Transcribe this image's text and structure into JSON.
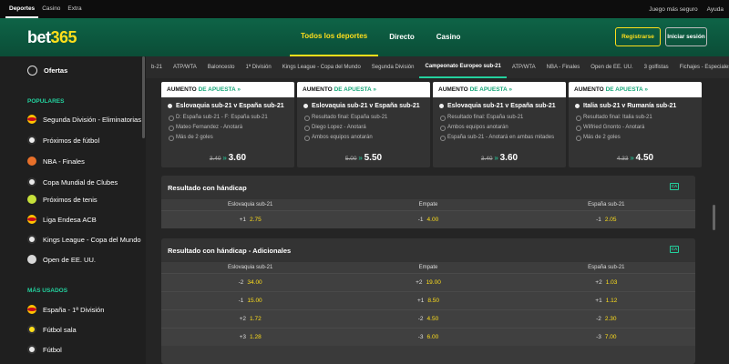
{
  "topbar": {
    "tabs": [
      "Deportes",
      "Casino",
      "Extra"
    ],
    "links": [
      "Juego más seguro",
      "Ayuda"
    ]
  },
  "header": {
    "logo_main": "bet",
    "logo_accent": "365",
    "nav": [
      "Todos los deportes",
      "Directo",
      "Casino"
    ],
    "register": "Registrarse",
    "login": "Iniciar sesión"
  },
  "sidebar": {
    "offers": "Ofertas",
    "popular_title": "POPULARES",
    "popular": [
      "Segunda División - Eliminatorias",
      "Próximos de fútbol",
      "NBA - Finales",
      "Copa Mundial de Clubes",
      "Próximos de tenis",
      "Liga Endesa ACB",
      "Kings League - Copa del Mundo",
      "Open de EE. UU."
    ],
    "most_used_title": "MÁS USADOS",
    "most_used": [
      "España - 1ª División",
      "Fútbol sala",
      "Fútbol"
    ]
  },
  "sports_strip": [
    "b-21",
    "ATP/WTA",
    "Baloncesto",
    "1ª División",
    "Kings League - Copa del Mundo",
    "Segunda División",
    "Campeonato Europeo sub-21",
    "ATP/WTA",
    "NBA - Finales",
    "Open de EE. UU.",
    "3 golfistas",
    "Fichajes - Especiales"
  ],
  "boosts": [
    {
      "label_a": "AUMENTO",
      "label_b": "DE APUESTA",
      "title": "Eslovaquia sub-21 v España sub-21",
      "lines": [
        "D: España sub-21 - F: España sub-21",
        "Mateo Fernandez - Anotará",
        "Más de 2 goles"
      ],
      "old": "3.40",
      "new": "3.60"
    },
    {
      "label_a": "AUMENTO",
      "label_b": "DE APUESTA",
      "title": "Eslovaquia sub-21 v España sub-21",
      "lines": [
        "Resultado final: España sub-21",
        "Diego Lopez - Anotará",
        "Ambos equipos anotarán"
      ],
      "old": "5.00",
      "new": "5.50"
    },
    {
      "label_a": "AUMENTO",
      "label_b": "DE APUESTA",
      "title": "Eslovaquia sub-21 v España sub-21",
      "lines": [
        "Resultado final: España sub-21",
        "Ambos equipos anotarán",
        "España sub-21 - Anotará en ambas mitades"
      ],
      "old": "3.40",
      "new": "3.60"
    },
    {
      "label_a": "AUMENTO",
      "label_b": "DE APUESTA",
      "title": "Italia sub-21 v Rumanía sub-21",
      "lines": [
        "Resultado final: Italia sub-21",
        "Wilfried Gnonto - Anotará",
        "Más de 2 goles"
      ],
      "old": "4.33",
      "new": "4.50"
    }
  ],
  "market1": {
    "title": "Resultado con hándicap",
    "badge": "CA",
    "cols": [
      "Eslovaquia sub-21",
      "Empate",
      "España sub-21"
    ],
    "rows": [
      [
        [
          "+1",
          "2.75"
        ],
        [
          "-1",
          "4.00"
        ],
        [
          "-1",
          "2.05"
        ]
      ]
    ]
  },
  "market2": {
    "title": "Resultado con hándicap - Adicionales",
    "badge": "CA",
    "cols": [
      "Eslovaquia sub-21",
      "Empate",
      "España sub-21"
    ],
    "rows": [
      [
        [
          "-2",
          "34.00"
        ],
        [
          "+2",
          "19.00"
        ],
        [
          "+2",
          "1.03"
        ]
      ],
      [
        [
          "-1",
          "15.00"
        ],
        [
          "+1",
          "8.50"
        ],
        [
          "+1",
          "1.12"
        ]
      ],
      [
        [
          "+2",
          "1.72"
        ],
        [
          "-2",
          "4.50"
        ],
        [
          "-2",
          "2.30"
        ]
      ],
      [
        [
          "+3",
          "1.28"
        ],
        [
          "-3",
          "6.00"
        ],
        [
          "-3",
          "7.00"
        ]
      ]
    ]
  },
  "colors": {
    "brand_green": "#0e6447",
    "accent_yellow": "#ffdf1b",
    "accent_teal": "#23d19e"
  }
}
